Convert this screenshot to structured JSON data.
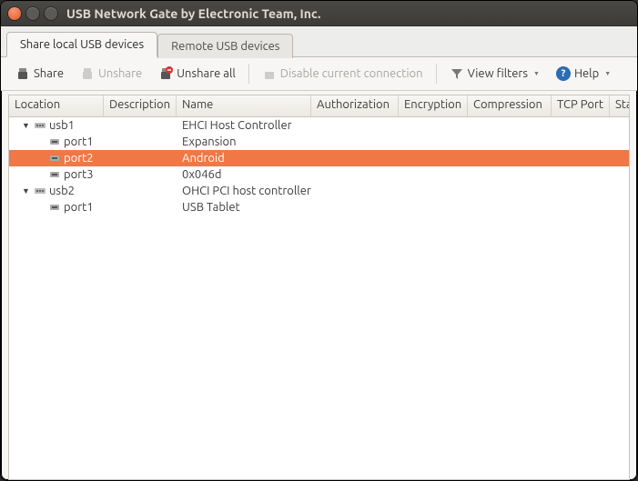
{
  "window": {
    "title": "USB Network Gate by Electronic Team, Inc."
  },
  "tabs": {
    "share_local": "Share local USB devices",
    "remote": "Remote USB devices"
  },
  "toolbar": {
    "share": "Share",
    "unshare": "Unshare",
    "unshare_all": "Unshare all",
    "disable_conn": "Disable current connection",
    "view_filters": "View filters",
    "help": "Help"
  },
  "columns": {
    "location": "Location",
    "description": "Description",
    "name": "Name",
    "authorization": "Authorization",
    "encryption": "Encryption",
    "compression": "Compression",
    "tcp_port": "TCP Port",
    "state": "State"
  },
  "rows": [
    {
      "indent": 1,
      "disclose": true,
      "icon": "usb-hub",
      "location": "usb1",
      "name": "EHCI Host Controller",
      "selected": false
    },
    {
      "indent": 2,
      "disclose": false,
      "icon": "usb-port",
      "location": "port1",
      "name": "Expansion",
      "selected": false
    },
    {
      "indent": 2,
      "disclose": false,
      "icon": "usb-port",
      "location": "port2",
      "name": "Android",
      "selected": true
    },
    {
      "indent": 2,
      "disclose": false,
      "icon": "usb-port",
      "location": "port3",
      "name": "0x046d",
      "selected": false
    },
    {
      "indent": 1,
      "disclose": true,
      "icon": "usb-hub",
      "location": "usb2",
      "name": "OHCI PCI host controller",
      "selected": false
    },
    {
      "indent": 2,
      "disclose": false,
      "icon": "usb-port",
      "location": "port1",
      "name": "USB Tablet",
      "selected": false
    }
  ]
}
